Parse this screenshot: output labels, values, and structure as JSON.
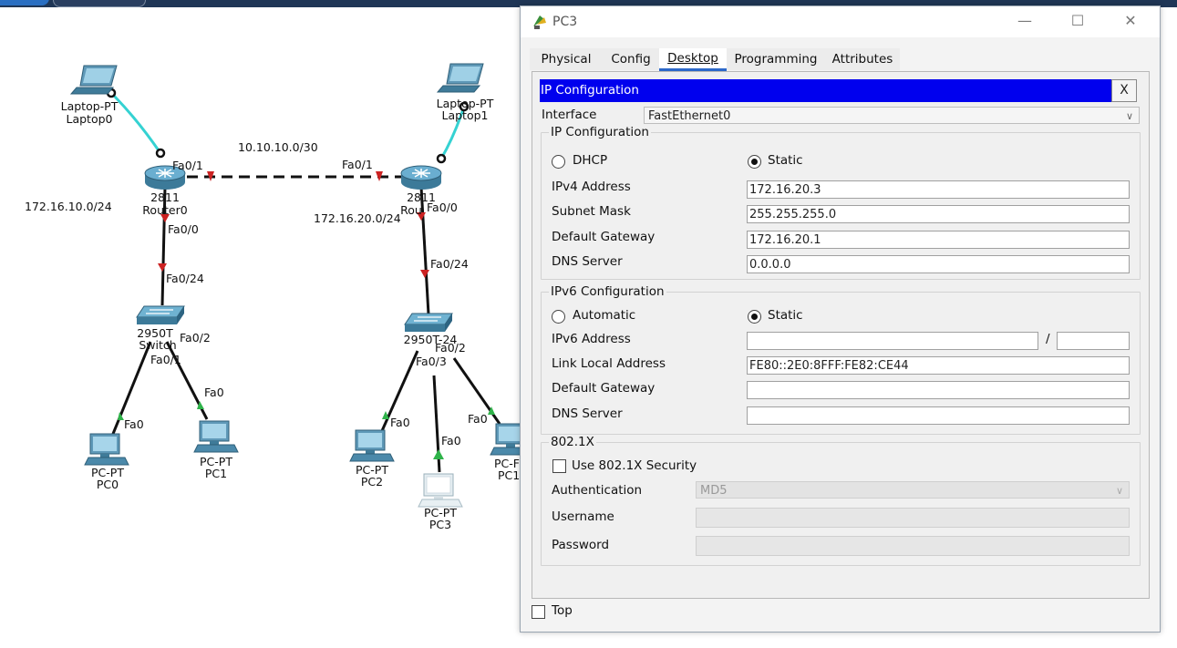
{
  "topology": {
    "networks": {
      "lan_left": "172.16.10.0/24",
      "wan": "10.10.10.0/30",
      "lan_right": "172.16.20.0/24"
    },
    "devices": {
      "laptop0_model": "Laptop-PT",
      "laptop0_name": "Laptop0",
      "laptop1_model": "Laptop-PT",
      "laptop1_name": "Laptop1",
      "router0_model": "2811",
      "router0_name": "Router0",
      "router1_model": "2811",
      "router1_name": "Rou",
      "switch0_model": "2950T",
      "switch0_name": "Switch",
      "switch1_model": "2950T-24",
      "pc0_model": "PC-PT",
      "pc0_name": "PC0",
      "pc1_model": "PC-PT",
      "pc1_name": "PC1",
      "pc2_model": "PC-PT",
      "pc2_name": "PC2",
      "pc3_model": "PC-PT",
      "pc3_name": "PC3",
      "pc_right_model": "PC-F",
      "pc_right_name": "PC1"
    },
    "ports": {
      "r0_fa01": "Fa0/1",
      "r0_fa00": "Fa0/0",
      "sw0_fa024": "Fa0/24",
      "sw0_fa02": "Fa0/2",
      "sw0_fa01": "Fa0/1",
      "pc1_fa0": "Fa0",
      "pc0_fa0": "Fa0",
      "r1_fa01": "Fa0/1",
      "r1_fa00": "Fa0/0",
      "sw1_fa024": "Fa0/24",
      "sw1_fa02": "Fa0/2",
      "sw1_fa03": "Fa0/3",
      "pc2_fa0": "Fa0",
      "pc3_fa0": "Fa0",
      "pcr_fa0": "Fa0"
    }
  },
  "window": {
    "title": "PC3",
    "minimize": "—",
    "maximize": "☐",
    "close": "✕",
    "tabs": [
      "Physical",
      "Config",
      "Desktop",
      "Programming",
      "Attributes"
    ],
    "active_tab": "Desktop",
    "header": "IP Configuration",
    "header_close": "X",
    "interface_label": "Interface",
    "interface_value": "FastEthernet0",
    "ipv4": {
      "group_label": "IP Configuration",
      "dhcp_label": "DHCP",
      "static_label": "Static",
      "mode": "Static",
      "address_label": "IPv4 Address",
      "address_value": "172.16.20.3",
      "mask_label": "Subnet Mask",
      "mask_value": "255.255.255.0",
      "gateway_label": "Default Gateway",
      "gateway_value": "172.16.20.1",
      "dns_label": "DNS Server",
      "dns_value": "0.0.0.0"
    },
    "ipv6": {
      "group_label": "IPv6 Configuration",
      "auto_label": "Automatic",
      "static_label": "Static",
      "mode": "Static",
      "address_label": "IPv6 Address",
      "address_value": "",
      "prefix_sep": "/",
      "prefix_value": "",
      "link_local_label": "Link Local Address",
      "link_local_value": "FE80::2E0:8FFF:FE82:CE44",
      "gateway_label": "Default Gateway",
      "gateway_value": "",
      "dns_label": "DNS Server",
      "dns_value": ""
    },
    "dot1x": {
      "group_label": "802.1X",
      "use_label": "Use 802.1X Security",
      "use_checked": false,
      "auth_label": "Authentication",
      "auth_value": "MD5",
      "username_label": "Username",
      "username_value": "",
      "password_label": "Password",
      "password_value": ""
    },
    "top_label": "Top",
    "top_checked": false
  },
  "colors": {
    "header_blue": "#0000ee",
    "cable_cyan": "#35d2d2",
    "cable_black": "#111111",
    "link_down_red": "#cc2222",
    "link_up_green": "#2fb34a",
    "device_blue": "#4a87a8"
  }
}
